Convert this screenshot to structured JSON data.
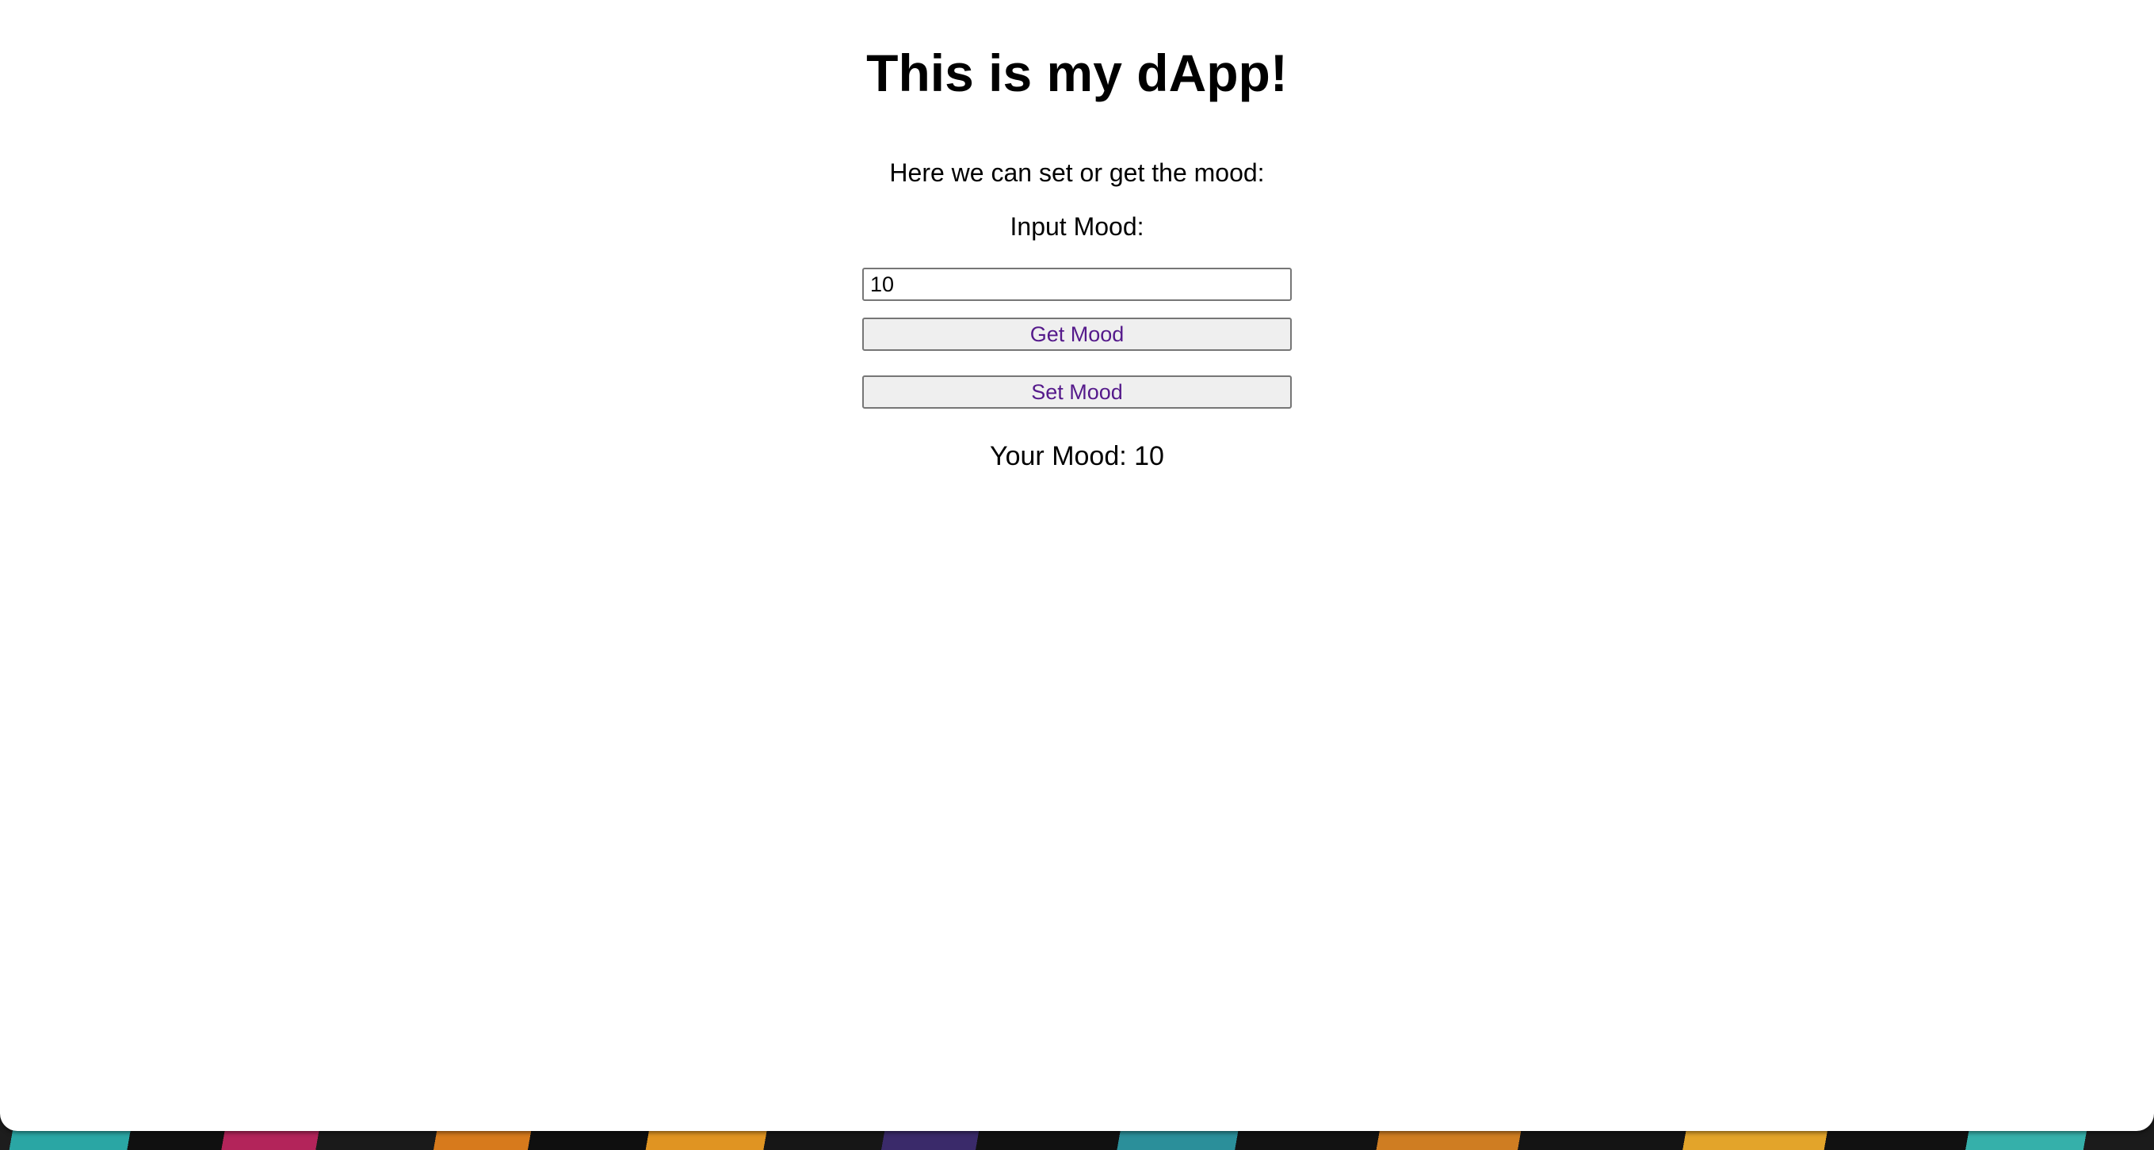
{
  "page": {
    "title": "This is my dApp!",
    "intro": "Here we can set or get the mood:",
    "input_label": "Input Mood:"
  },
  "form": {
    "mood_value": "10",
    "get_button_label": "Get Mood",
    "set_button_label": "Set Mood"
  },
  "result": {
    "mood_text": "Your Mood: 10"
  },
  "colors": {
    "button_text": "#551a8b",
    "button_bg": "#efefef",
    "page_bg": "#ffffff"
  }
}
